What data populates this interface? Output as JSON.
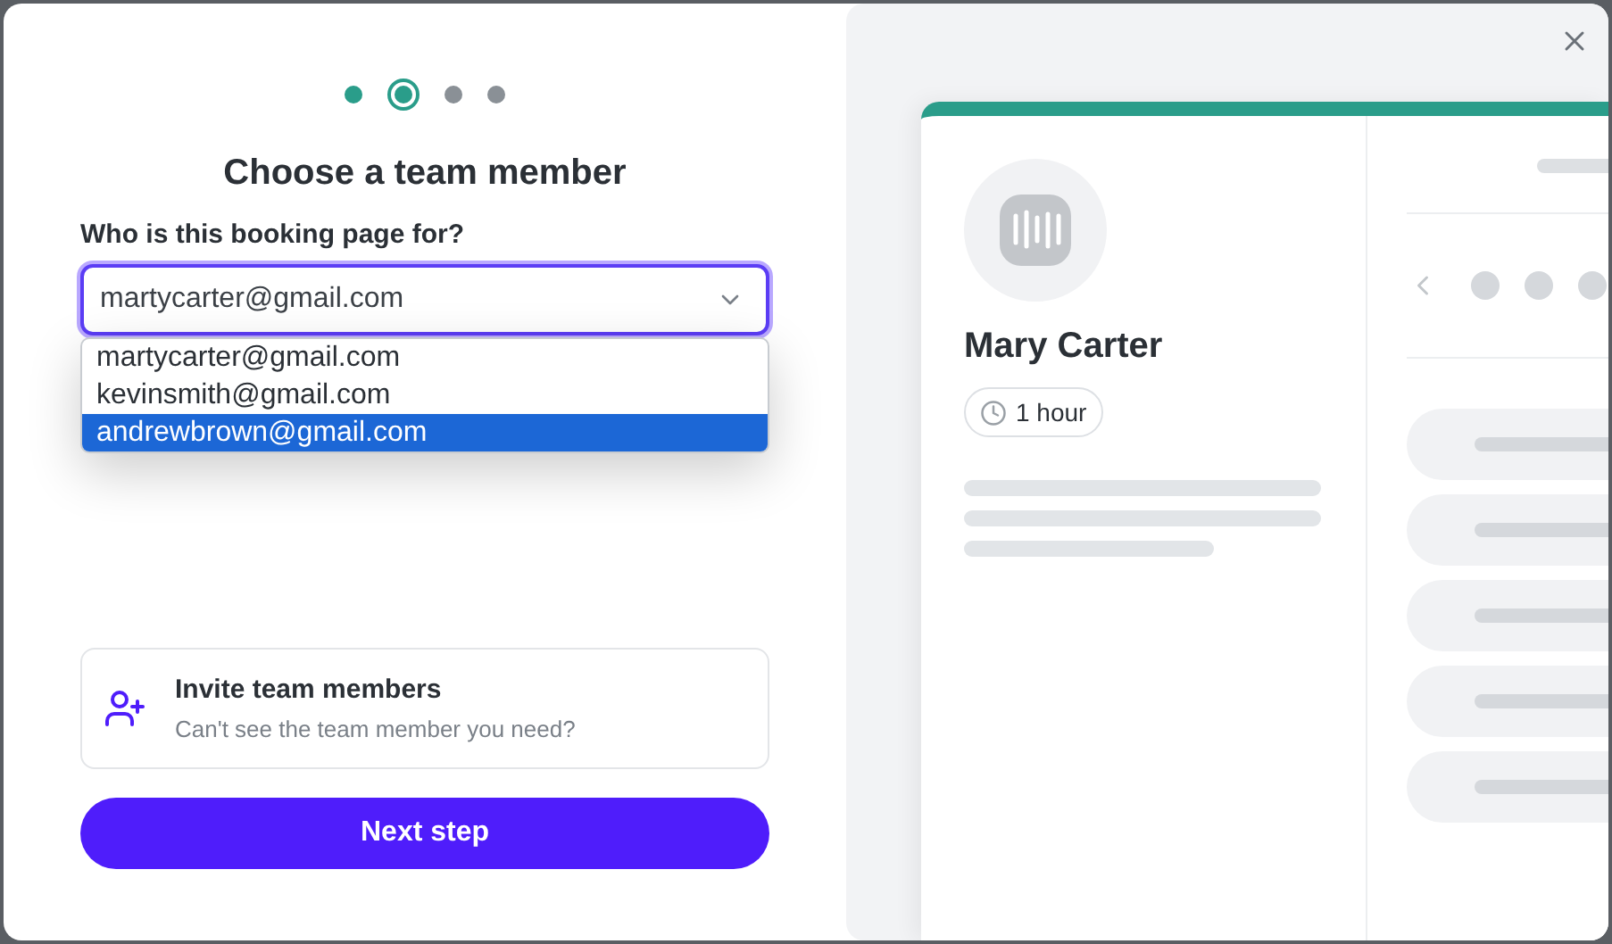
{
  "steps": [
    {
      "selected": false,
      "completed": true
    },
    {
      "selected": true,
      "completed": false
    },
    {
      "selected": false,
      "completed": false
    },
    {
      "selected": false,
      "completed": false
    }
  ],
  "title": "Choose a team member",
  "field": {
    "label": "Who is this booking page for?",
    "value": "martycarter@gmail.com",
    "expanded": true,
    "options": [
      {
        "label": "martycarter@gmail.com",
        "highlighted": false
      },
      {
        "label": "kevinsmith@gmail.com",
        "highlighted": false
      },
      {
        "label": "andrewbrown@gmail.com",
        "highlighted": true
      }
    ]
  },
  "invite": {
    "title": "Invite team members",
    "subtitle": "Can't see the team member you need?"
  },
  "next_button": "Next step",
  "preview": {
    "name": "Mary Carter",
    "duration": "1 hour"
  }
}
